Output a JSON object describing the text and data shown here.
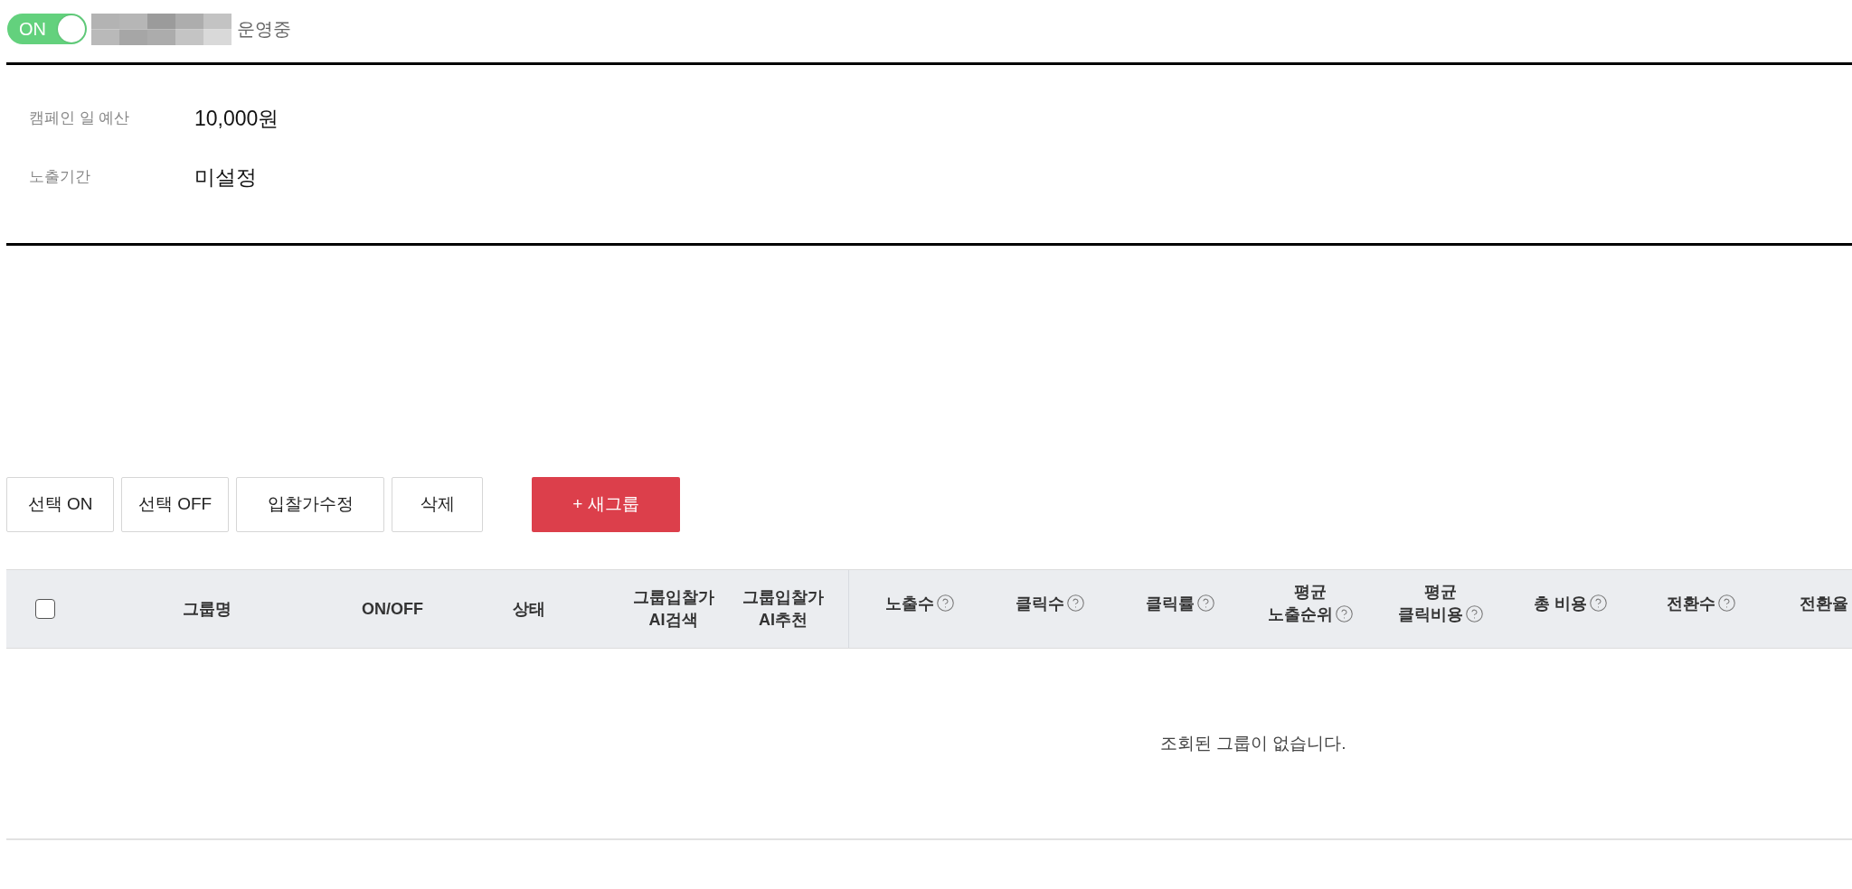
{
  "status": {
    "toggle": {
      "label": "ON",
      "on": true
    },
    "text": "운영중"
  },
  "campaign_info": [
    {
      "label": "캠페인 일 예산",
      "value": "10,000원"
    },
    {
      "label": "노출기간",
      "value": "미설정"
    }
  ],
  "actions": [
    {
      "label": "선택 ON",
      "kind": "outline"
    },
    {
      "label": "선택 OFF",
      "kind": "outline"
    },
    {
      "label": "입찰가수정",
      "kind": "outline"
    },
    {
      "label": "삭제",
      "kind": "outline"
    },
    {
      "label": "+ 새그룹",
      "kind": "primary"
    }
  ],
  "table": {
    "select_all": {
      "checked": false
    },
    "column_groups": [
      {
        "columns": [
          {
            "label": "그룹명",
            "help": false
          },
          {
            "label": "ON/OFF",
            "help": false
          },
          {
            "label": "상태",
            "help": false
          },
          {
            "label": "그룹입찰가\nAI검색",
            "help": false
          },
          {
            "label": "그룹입찰가\nAI추천",
            "help": false
          }
        ]
      },
      {
        "columns": [
          {
            "label": "노출수",
            "help": true
          },
          {
            "label": "클릭수",
            "help": true
          },
          {
            "label": "클릭률",
            "help": true
          },
          {
            "label": "평균\n노출순위",
            "help": true
          },
          {
            "label": "평균\n클릭비용",
            "help": true
          },
          {
            "label": "총 비용",
            "help": true
          },
          {
            "label": "전환수",
            "help": true
          },
          {
            "label": "전환율",
            "help": false
          }
        ]
      }
    ],
    "empty_message": "조회된 그룹이 없습니다."
  }
}
